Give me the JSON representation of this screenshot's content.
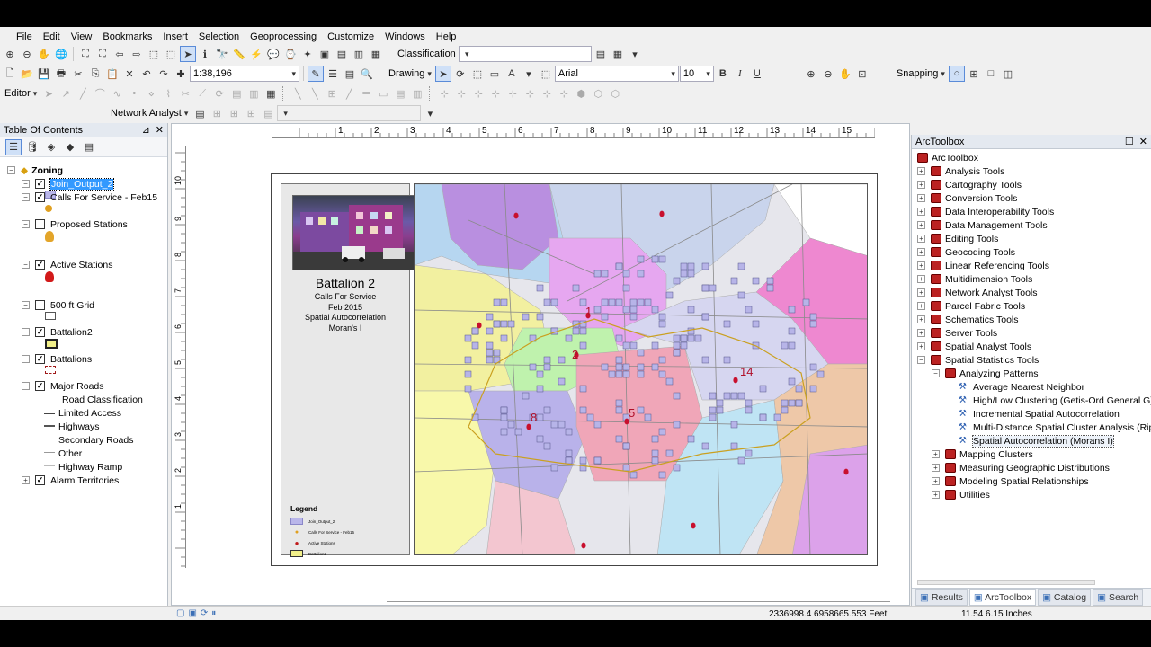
{
  "menu": [
    "File",
    "Edit",
    "View",
    "Bookmarks",
    "Insert",
    "Selection",
    "Geoprocessing",
    "Customize",
    "Windows",
    "Help"
  ],
  "toolbar": {
    "classification_label": "Classification",
    "scale_value": "1:38,196",
    "drawing_label": "Drawing",
    "font_name": "Arial",
    "font_size": "10",
    "bold": "B",
    "italic": "I",
    "underline": "U",
    "snapping_label": "Snapping",
    "editor_label": "Editor",
    "network_analyst_label": "Network Analyst"
  },
  "toc": {
    "title": "Table Of Contents",
    "group_name": "Zoning",
    "layers": [
      {
        "name": "Join_Output_2",
        "checked": true,
        "selected": true
      },
      {
        "name": "Calls For Service - Feb15",
        "checked": true
      },
      {
        "name": "Proposed Stations",
        "checked": false
      },
      {
        "name": "Active Stations",
        "checked": true
      },
      {
        "name": "500 ft Grid",
        "checked": false
      },
      {
        "name": "Battalion2",
        "checked": true
      },
      {
        "name": "Battalions",
        "checked": true
      },
      {
        "name": "Major Roads",
        "checked": true
      },
      {
        "name": "Alarm Territories",
        "checked": true
      }
    ],
    "road_classification_header": "Road Classification",
    "road_classes": [
      "Limited Access",
      "Highways",
      "Secondary Roads",
      "Other",
      "Highway Ramp"
    ]
  },
  "ruler": {
    "horizontal": [
      "1",
      "2",
      "3",
      "4",
      "5",
      "6",
      "7",
      "8",
      "9",
      "10",
      "11",
      "12",
      "13",
      "14",
      "15",
      "16"
    ],
    "vertical": [
      "10",
      "9",
      "8",
      "7",
      "6",
      "5",
      "4",
      "3",
      "2",
      "1"
    ]
  },
  "layout": {
    "title": "Battalion 2",
    "subtitle_lines": [
      "Calls For Service",
      "Feb 2015",
      "Spatial Autocorrelation",
      "Moran's I"
    ],
    "legend_title": "Legend",
    "legend_items": [
      "Join_Output_2",
      "Calls For Service - Feb15",
      "Active Stations",
      "Battalion2"
    ],
    "station_numbers": [
      "1",
      "2",
      "5",
      "8",
      "14"
    ]
  },
  "toolbox": {
    "title": "ArcToolbox",
    "root": "ArcToolbox",
    "toolsets": [
      "Analysis Tools",
      "Cartography Tools",
      "Conversion Tools",
      "Data Interoperability Tools",
      "Data Management Tools",
      "Editing Tools",
      "Geocoding Tools",
      "Linear Referencing Tools",
      "Multidimension Tools",
      "Network Analyst Tools",
      "Parcel Fabric Tools",
      "Schematics Tools",
      "Server Tools",
      "Spatial Analyst Tools",
      "Spatial Statistics Tools"
    ],
    "analyzing_patterns": "Analyzing Patterns",
    "pattern_tools": [
      "Average Nearest Neighbor",
      "High/Low Clustering (Getis-Ord General G)",
      "Incremental Spatial Autocorrelation",
      "Multi-Distance Spatial Cluster Analysis (Ripley",
      "Spatial Autocorrelation (Morans I)"
    ],
    "other_subsets": [
      "Mapping Clusters",
      "Measuring Geographic Distributions",
      "Modeling Spatial Relationships",
      "Utilities"
    ],
    "tabs": [
      "Results",
      "ArcToolbox",
      "Catalog",
      "Search"
    ]
  },
  "status": {
    "coordinates": "2336998.4  6958665.553 Feet",
    "page_coords": "11.54  6.15 Inches"
  }
}
